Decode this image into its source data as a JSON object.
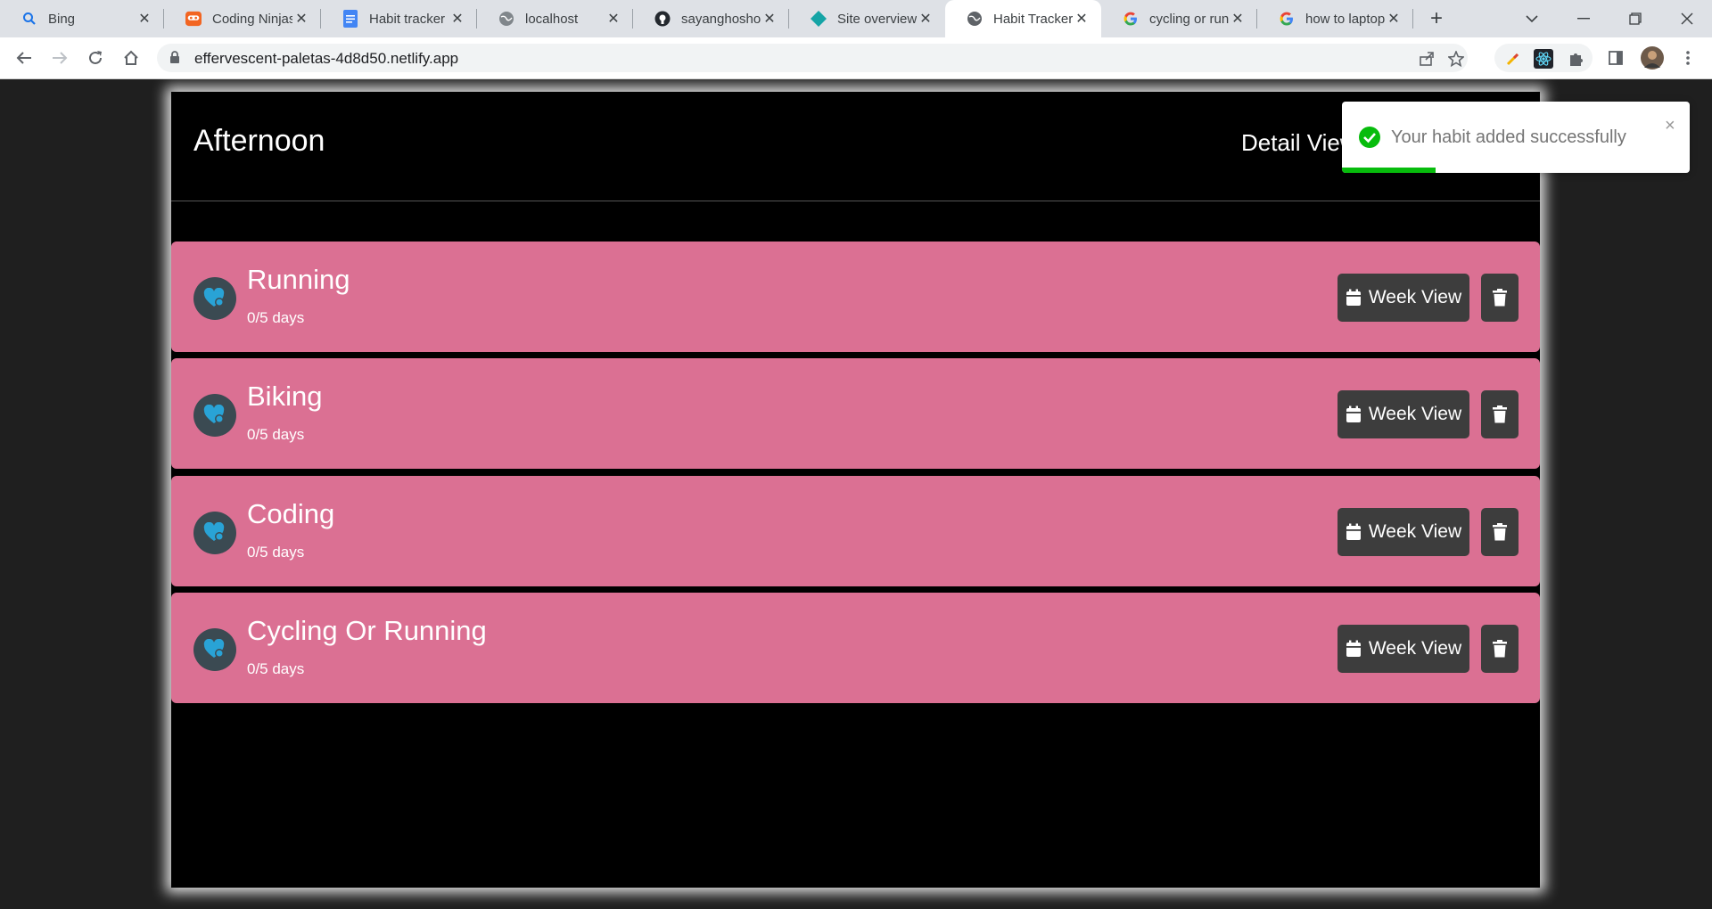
{
  "browser": {
    "tabs": [
      {
        "title": "Bing",
        "icon": "bing-search-icon"
      },
      {
        "title": "Coding Ninjas",
        "icon": "coding-ninjas-icon"
      },
      {
        "title": "Habit tracker F",
        "icon": "google-docs-icon"
      },
      {
        "title": "localhost",
        "icon": "globe-icon"
      },
      {
        "title": "sayanghoshofi",
        "icon": "github-icon"
      },
      {
        "title": "Site overview |",
        "icon": "netlify-icon"
      },
      {
        "title": "Habit Tracker",
        "icon": "globe-icon",
        "active": true
      },
      {
        "title": "cycling or runn",
        "icon": "google-icon"
      },
      {
        "title": "how to laptop",
        "icon": "google-icon"
      }
    ],
    "url": "effervescent-paletas-4d8d50.netlify.app"
  },
  "app": {
    "title": "Afternoon",
    "detail_view_label": "Detail View",
    "colors": {
      "card": "#db7093",
      "button": "#3d3d3d",
      "icon_bg": "#3b4a52",
      "icon_fg": "#29a3d6"
    },
    "habits": [
      {
        "name": "Running",
        "progress": "0/5 days",
        "week_view_label": "Week View"
      },
      {
        "name": "Biking",
        "progress": "0/5 days",
        "week_view_label": "Week View"
      },
      {
        "name": "Coding",
        "progress": "0/5 days",
        "week_view_label": "Week View"
      },
      {
        "name": "Cycling Or Running",
        "progress": "0/5 days",
        "week_view_label": "Week View"
      }
    ]
  },
  "toast": {
    "message": "Your habit added successfully",
    "close_glyph": "×",
    "progress_fraction": 0.27,
    "color": "#07bc0c"
  }
}
